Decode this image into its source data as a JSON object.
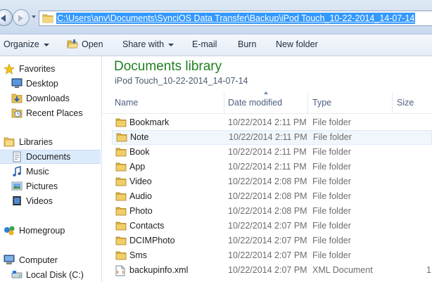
{
  "address": {
    "path": "C:\\Users\\anv\\Documents\\SynciOS Data Transfer\\Backup\\iPod Touch_10-22-2014_14-07-14"
  },
  "toolbar": {
    "organize_label": "Organize",
    "open_label": "Open",
    "share_label": "Share with",
    "email_label": "E-mail",
    "burn_label": "Burn",
    "new_folder_label": "New folder"
  },
  "nav": {
    "favorites": "Favorites",
    "desktop": "Desktop",
    "downloads": "Downloads",
    "recent": "Recent Places",
    "libraries": "Libraries",
    "documents": "Documents",
    "music": "Music",
    "pictures": "Pictures",
    "videos": "Videos",
    "homegroup": "Homegroup",
    "computer": "Computer",
    "local_disk": "Local Disk (C:)"
  },
  "library": {
    "title": "Documents library",
    "subtitle": "iPod Touch_10-22-2014_14-07-14"
  },
  "columns": {
    "name": "Name",
    "date": "Date modified",
    "type": "Type",
    "size": "Size"
  },
  "files": [
    {
      "name": "Bookmark",
      "date": "10/22/2014 2:11 PM",
      "type": "File folder",
      "size": "",
      "icon": "folder-icon"
    },
    {
      "name": "Note",
      "date": "10/22/2014 2:11 PM",
      "type": "File folder",
      "size": "",
      "icon": "folder-icon"
    },
    {
      "name": "Book",
      "date": "10/22/2014 2:11 PM",
      "type": "File folder",
      "size": "",
      "icon": "folder-icon"
    },
    {
      "name": "App",
      "date": "10/22/2014 2:11 PM",
      "type": "File folder",
      "size": "",
      "icon": "folder-icon"
    },
    {
      "name": "Video",
      "date": "10/22/2014 2:08 PM",
      "type": "File folder",
      "size": "",
      "icon": "folder-icon"
    },
    {
      "name": "Audio",
      "date": "10/22/2014 2:08 PM",
      "type": "File folder",
      "size": "",
      "icon": "folder-icon"
    },
    {
      "name": "Photo",
      "date": "10/22/2014 2:08 PM",
      "type": "File folder",
      "size": "",
      "icon": "folder-icon"
    },
    {
      "name": "Contacts",
      "date": "10/22/2014 2:07 PM",
      "type": "File folder",
      "size": "",
      "icon": "folder-icon"
    },
    {
      "name": "DCIMPhoto",
      "date": "10/22/2014 2:07 PM",
      "type": "File folder",
      "size": "",
      "icon": "folder-icon"
    },
    {
      "name": "Sms",
      "date": "10/22/2014 2:07 PM",
      "type": "File folder",
      "size": "",
      "icon": "folder-icon"
    },
    {
      "name": "backupinfo.xml",
      "date": "10/22/2014 2:07 PM",
      "type": "XML Document",
      "size": "1",
      "icon": "xml-file-icon"
    }
  ],
  "colors": {
    "selection": "#3399ff",
    "library_title": "#1f7f1f",
    "folder": "#e8c25a"
  }
}
